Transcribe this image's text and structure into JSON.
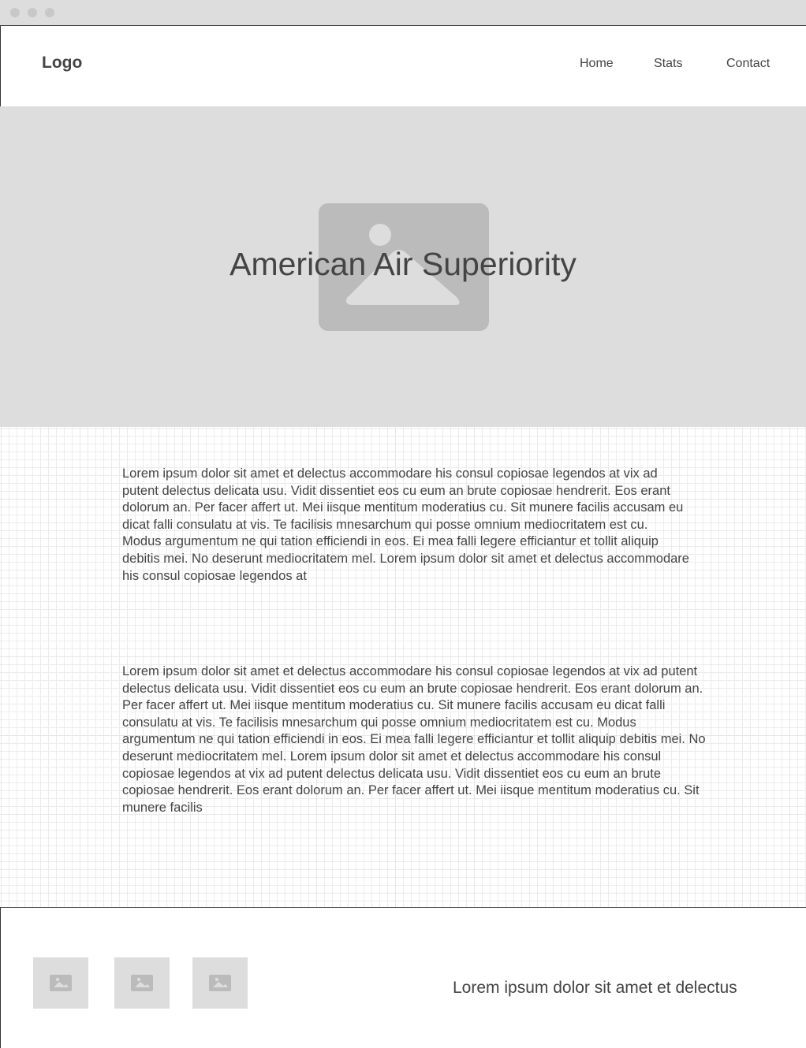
{
  "header": {
    "logo": "Logo",
    "nav": [
      "Home",
      "Stats",
      "Contact"
    ]
  },
  "hero": {
    "title": "American Air Superiority",
    "image_icon": "image-placeholder-icon"
  },
  "content": {
    "paragraphs": [
      "Lorem ipsum dolor sit amet et delectus accommodare his consul copiosae legendos at vix ad putent delectus delicata usu. Vidit dissentiet eos cu eum an brute copiosae hendrerit. Eos erant dolorum an. Per facer affert ut. Mei iisque mentitum moderatius cu. Sit munere facilis accusam eu dicat falli consulatu at vis. Te facilisis mnesarchum qui posse omnium mediocritatem est cu. Modus argumentum ne qui tation efficiendi in eos. Ei mea falli legere efficiantur et tollit aliquip debitis mei. No deserunt mediocritatem mel. Lorem ipsum dolor sit amet et delectus accommodare his consul copiosae legendos at",
      "Lorem ipsum dolor sit amet et delectus accommodare his consul copiosae legendos at vix ad putent delectus delicata usu. Vidit dissentiet eos cu eum an brute copiosae hendrerit. Eos erant dolorum an. Per facer affert ut. Mei iisque mentitum moderatius cu. Sit munere facilis accusam eu dicat falli consulatu at vis. Te facilisis mnesarchum qui posse omnium mediocritatem est cu. Modus argumentum ne qui tation efficiendi in eos. Ei mea falli legere efficiantur et tollit aliquip debitis mei. No deserunt mediocritatem mel. Lorem ipsum dolor sit amet et delectus accommodare his consul copiosae legendos at vix ad putent delectus delicata usu. Vidit dissentiet eos cu eum an brute copiosae hendrerit. Eos erant dolorum an. Per facer affert ut. Mei iisque mentitum moderatius cu. Sit munere facilis"
    ]
  },
  "footer": {
    "thumbnails": [
      "image-placeholder-icon",
      "image-placeholder-icon",
      "image-placeholder-icon"
    ],
    "text": "Lorem ipsum dolor sit amet et delectus"
  },
  "colors": {
    "placeholder_fill": "#dddddd",
    "image_fill": "#bbbbbb",
    "text": "#444444"
  }
}
